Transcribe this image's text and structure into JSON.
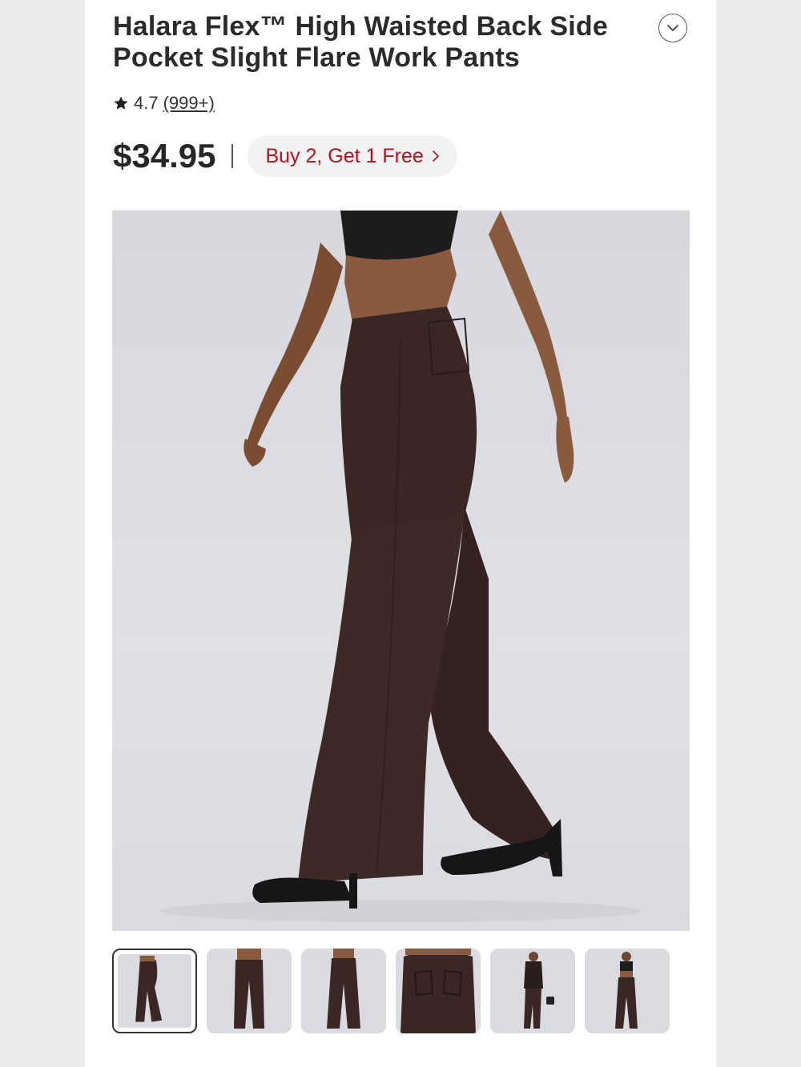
{
  "product": {
    "title": "Halara Flex™ High Waisted Back Side Pocket Slight Flare Work Pants",
    "rating": "4.7",
    "reviews": "(999+)",
    "price": "$34.95",
    "promo_label": "Buy 2, Get 1 Free"
  },
  "icons": {
    "expand": "chevron-down-icon",
    "star": "star-icon",
    "promo_arrow": "chevron-right-icon"
  },
  "colors": {
    "promo_text": "#b5121b",
    "pants": "#3a2724"
  },
  "gallery": {
    "selected_index": 0,
    "thumbnail_count": 6
  }
}
